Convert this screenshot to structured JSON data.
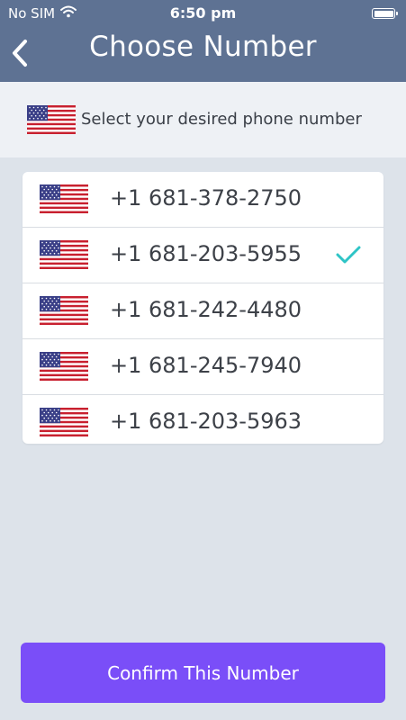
{
  "status_bar": {
    "carrier": "No SIM",
    "time": "6:50 pm"
  },
  "header": {
    "title": "Choose Number",
    "back_icon": "chevron-left-icon"
  },
  "instruction": {
    "text": "Select your desired phone number",
    "flag_icon": "us-flag-icon"
  },
  "numbers": [
    {
      "number": "+1 681-378-2750",
      "selected": false
    },
    {
      "number": "+1 681-203-5955",
      "selected": true
    },
    {
      "number": "+1 681-242-4480",
      "selected": false
    },
    {
      "number": "+1 681-245-7940",
      "selected": false
    },
    {
      "number": "+1 681-203-5963",
      "selected": false
    }
  ],
  "confirm_button": {
    "label": "Confirm This Number"
  },
  "colors": {
    "header": "#5e7293",
    "accent_button": "#7a4ef8",
    "check": "#2ec4c6",
    "background": "#dde3ea"
  }
}
